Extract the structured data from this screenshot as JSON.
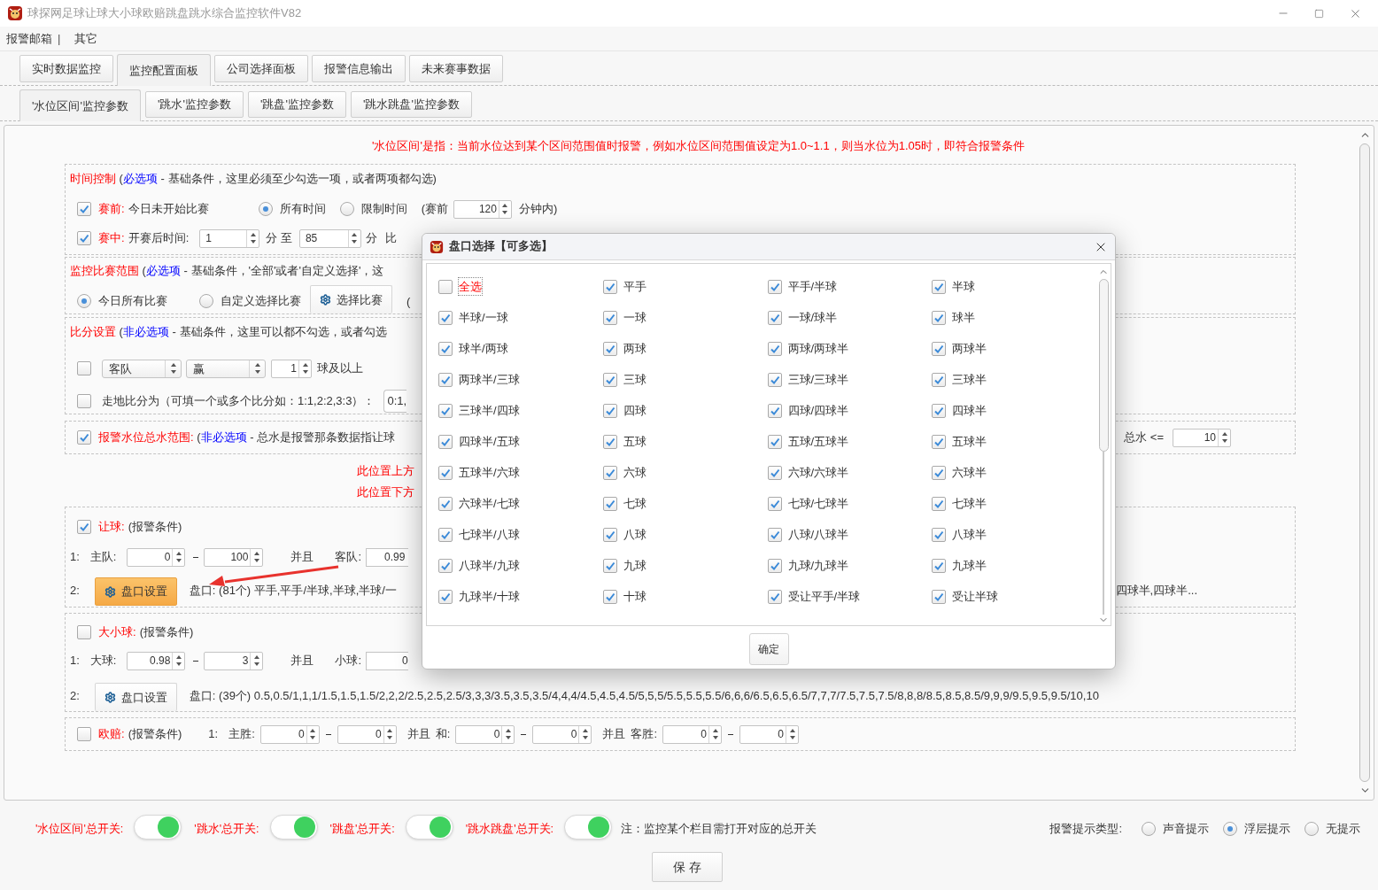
{
  "window": {
    "title": "球探网足球让球大小球欧赔跳盘跳水综合监控软件V82"
  },
  "menu": [
    {
      "kind": "item",
      "label": "报警邮箱"
    },
    {
      "kind": "separator",
      "label": "|"
    },
    {
      "kind": "item",
      "label": "其它"
    }
  ],
  "tabs": [
    {
      "label": "实时数据监控",
      "selected": false
    },
    {
      "label": "监控配置面板",
      "selected": true
    },
    {
      "label": "公司选择面板",
      "selected": false
    },
    {
      "label": "报警信息输出",
      "selected": false
    },
    {
      "label": "未来赛事数据",
      "selected": false
    }
  ],
  "subtabs": [
    {
      "label": "'水位区间'监控参数",
      "selected": true
    },
    {
      "label": "'跳水'监控参数",
      "selected": false
    },
    {
      "label": "'跳盘'监控参数",
      "selected": false
    },
    {
      "label": "'跳水跳盘'监控参数",
      "selected": false
    }
  ],
  "notice": "'水位区间'是指：当前水位达到某个区间范围值时报警，例如水位区间范围值设定为1.0~1.1，则当水位为1.05时，即符合报警条件",
  "time_control": {
    "heading": [
      {
        "kind": "title",
        "text": "时间控制"
      },
      {
        "kind": "text",
        "text": " ("
      },
      {
        "kind": "tag",
        "text": "必选项"
      },
      {
        "kind": "text",
        "text": " - 基础条件，这里必须至少勾选一项，或者两项都勾选)"
      }
    ],
    "pre_match": {
      "checked": true,
      "label": "赛前:",
      "text": "今日未开始比赛"
    },
    "time_options": [
      {
        "label": "所有时间",
        "selected": true
      },
      {
        "label": "限制时间",
        "selected": false
      }
    ],
    "before_label": "(赛前",
    "minutes": "120",
    "minutes_suffix": "分钟内)",
    "in_play": {
      "checked": true,
      "label": "赛中:",
      "text": "开赛后时间:",
      "from": "1",
      "mid": "分 至",
      "to": "85",
      "unit": "分",
      "tail": "比"
    }
  },
  "match_scope": {
    "heading": [
      {
        "kind": "title",
        "text": "监控比赛范围"
      },
      {
        "kind": "text",
        "text": " ("
      },
      {
        "kind": "tag",
        "text": "必选项"
      },
      {
        "kind": "text",
        "text": " - 基础条件，'全部'或者'自定义选择'，这"
      }
    ],
    "options": [
      {
        "label": "今日所有比赛",
        "selected": true
      },
      {
        "label": "自定义选择比赛",
        "selected": false
      }
    ],
    "button": "选择比赛",
    "tail": "("
  },
  "score": {
    "heading": [
      {
        "kind": "title",
        "text": "比分设置"
      },
      {
        "kind": "text",
        "text": " ("
      },
      {
        "kind": "tag",
        "text": "非必选项"
      },
      {
        "kind": "text",
        "text": " - 基础条件，这里可以都不勾选，或者勾选"
      }
    ],
    "goal_rule": {
      "checked": false,
      "team": "客队",
      "result": "赢",
      "goals": "1",
      "suffix": "球及以上"
    },
    "live_score": {
      "checked": false,
      "label": "走地比分为（可填一个或多个比分如：1:1,2:2,3:3）：",
      "value": "0:1,"
    }
  },
  "water_range": {
    "checked": true,
    "heading": [
      {
        "kind": "title",
        "text": "报警水位总水范围:"
      },
      {
        "kind": "text",
        "text": " ("
      },
      {
        "kind": "tag",
        "text": "非必选项"
      },
      {
        "kind": "text",
        "text": " - 总水是报警那条数据指让球"
      }
    ],
    "total_label": "总水 <=",
    "total_value": "10"
  },
  "markers": [
    "此位置上方",
    "此位置下方"
  ],
  "handicap": {
    "checked": true,
    "title": "让球:",
    "cond": "(报警条件)",
    "index1": "1:",
    "home_label": "主队:",
    "home_from": "0",
    "home_to": "100",
    "and": "并且",
    "away_label": "客队:",
    "away_from": "0.99",
    "index2": "2:",
    "button": "盘口设置",
    "highlighted": true,
    "lines": "盘口: (81个) 平手,平手/半球,半球,半球/一",
    "lines_tail": "四球半,四球半..."
  },
  "over_under": {
    "checked": false,
    "title": "大小球:",
    "cond": "(报警条件)",
    "index1": "1:",
    "over_label": "大球:",
    "over_from": "0.98",
    "over_to": "3",
    "and": "并且",
    "under_label": "小球:",
    "under_from": "0",
    "index2": "2:",
    "button": "盘口设置",
    "highlighted": false,
    "lines": "盘口: (39个) 0.5,0.5/1,1,1/1.5,1.5,1.5/2,2,2/2.5,2.5,2.5/3,3,3/3.5,3.5,3.5/4,4,4/4.5,4.5,4.5/5,5,5/5.5,5.5,5.5/6,6,6/6.5,6.5,6.5/7,7,7/7.5,7.5,7.5/8,8,8/8.5,8.5,8.5/9,9,9/9.5,9.5,9.5/10,10"
  },
  "european": {
    "checked": false,
    "title": "欧赔:",
    "cond": "(报警条件)",
    "index": "1:",
    "groups": [
      {
        "label": "主胜:",
        "from": "0",
        "to": "0"
      },
      {
        "prefix": "并且",
        "label": "和:",
        "from": "0",
        "to": "0"
      },
      {
        "prefix": "并且",
        "label": "客胜:",
        "from": "0",
        "to": "0"
      }
    ]
  },
  "switches": [
    {
      "label": "'水位区间'总开关:",
      "on": true
    },
    {
      "label": "'跳水'总开关:",
      "on": true
    },
    {
      "label": "'跳盘'总开关:",
      "on": true
    },
    {
      "label": "'跳水跳盘'总开关:",
      "on": true
    }
  ],
  "switch_note": "注：监控某个栏目需打开对应的总开关",
  "alert_type": {
    "label": "报警提示类型:",
    "options": [
      {
        "label": "声音提示",
        "selected": false
      },
      {
        "label": "浮层提示",
        "selected": true
      },
      {
        "label": "无提示",
        "selected": false
      }
    ]
  },
  "save": "保 存",
  "dialog": {
    "title": "盘口选择【可多选】",
    "confirm": "确定",
    "items": [
      {
        "kind": "select_all",
        "label": "全选",
        "checked": false
      },
      {
        "kind": "line",
        "label": "平手",
        "checked": true
      },
      {
        "kind": "line",
        "label": "平手/半球",
        "checked": true
      },
      {
        "kind": "line",
        "label": "半球",
        "checked": true
      },
      {
        "kind": "line",
        "label": "半球/一球",
        "checked": true
      },
      {
        "kind": "line",
        "label": "一球",
        "checked": true
      },
      {
        "kind": "line",
        "label": "一球/球半",
        "checked": true
      },
      {
        "kind": "line",
        "label": "球半",
        "checked": true
      },
      {
        "kind": "line",
        "label": "球半/两球",
        "checked": true
      },
      {
        "kind": "line",
        "label": "两球",
        "checked": true
      },
      {
        "kind": "line",
        "label": "两球/两球半",
        "checked": true
      },
      {
        "kind": "line",
        "label": "两球半",
        "checked": true
      },
      {
        "kind": "line",
        "label": "两球半/三球",
        "checked": true
      },
      {
        "kind": "line",
        "label": "三球",
        "checked": true
      },
      {
        "kind": "line",
        "label": "三球/三球半",
        "checked": true
      },
      {
        "kind": "line",
        "label": "三球半",
        "checked": true
      },
      {
        "kind": "line",
        "label": "三球半/四球",
        "checked": true
      },
      {
        "kind": "line",
        "label": "四球",
        "checked": true
      },
      {
        "kind": "line",
        "label": "四球/四球半",
        "checked": true
      },
      {
        "kind": "line",
        "label": "四球半",
        "checked": true
      },
      {
        "kind": "line",
        "label": "四球半/五球",
        "checked": true
      },
      {
        "kind": "line",
        "label": "五球",
        "checked": true
      },
      {
        "kind": "line",
        "label": "五球/五球半",
        "checked": true
      },
      {
        "kind": "line",
        "label": "五球半",
        "checked": true
      },
      {
        "kind": "line",
        "label": "五球半/六球",
        "checked": true
      },
      {
        "kind": "line",
        "label": "六球",
        "checked": true
      },
      {
        "kind": "line",
        "label": "六球/六球半",
        "checked": true
      },
      {
        "kind": "line",
        "label": "六球半",
        "checked": true
      },
      {
        "kind": "line",
        "label": "六球半/七球",
        "checked": true
      },
      {
        "kind": "line",
        "label": "七球",
        "checked": true
      },
      {
        "kind": "line",
        "label": "七球/七球半",
        "checked": true
      },
      {
        "kind": "line",
        "label": "七球半",
        "checked": true
      },
      {
        "kind": "line",
        "label": "七球半/八球",
        "checked": true
      },
      {
        "kind": "line",
        "label": "八球",
        "checked": true
      },
      {
        "kind": "line",
        "label": "八球/八球半",
        "checked": true
      },
      {
        "kind": "line",
        "label": "八球半",
        "checked": true
      },
      {
        "kind": "line",
        "label": "八球半/九球",
        "checked": true
      },
      {
        "kind": "line",
        "label": "九球",
        "checked": true
      },
      {
        "kind": "line",
        "label": "九球/九球半",
        "checked": true
      },
      {
        "kind": "line",
        "label": "九球半",
        "checked": true
      },
      {
        "kind": "line",
        "label": "九球半/十球",
        "checked": true
      },
      {
        "kind": "line",
        "label": "十球",
        "checked": true
      },
      {
        "kind": "line",
        "label": "受让平手/半球",
        "checked": true
      },
      {
        "kind": "line",
        "label": "受让半球",
        "checked": true
      }
    ]
  }
}
